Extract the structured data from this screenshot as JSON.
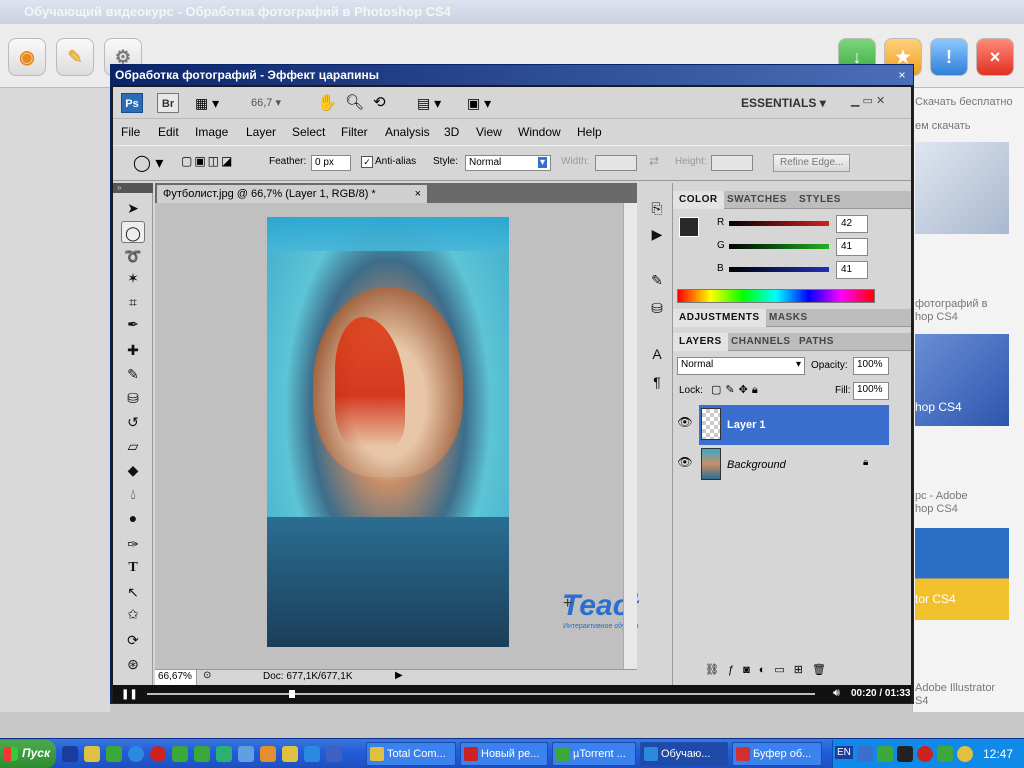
{
  "background_app": {
    "title": "Обучающий видеокурс - Обработка фотографий в Photoshop CS4",
    "side_texts": [
      "Скачать бесплатно",
      "ем скачать",
      "фотографий в",
      "hop CS4",
      "pc - Adobe",
      "hop CS4",
      "Adobe Illustrator",
      "S4"
    ],
    "thumb_texts": [
      "hop CS4",
      "tor CS4"
    ]
  },
  "video_window": {
    "title": "Обработка фотографий - Эффект царапины",
    "close_label": "×"
  },
  "photoshop": {
    "zoom_value": "66,7",
    "workspace_label": "ESSENTIALS",
    "menu": [
      "File",
      "Edit",
      "Image",
      "Layer",
      "Select",
      "Filter",
      "Analysis",
      "3D",
      "View",
      "Window",
      "Help"
    ],
    "options": {
      "feather_label": "Feather:",
      "feather_value": "0 px",
      "antialias_label": "Anti-alias",
      "style_label": "Style:",
      "style_value": "Normal",
      "width_label": "Width:",
      "height_label": "Height:",
      "refine_label": "Refine Edge..."
    },
    "document": {
      "tab_title": "Футболист.jpg @ 66,7% (Layer 1, RGB/8) *",
      "status_zoom": "66,67%",
      "status_doc": "Doc: 677,1K/677,1K"
    },
    "color_panel": {
      "tabs": [
        "COLOR",
        "SWATCHES",
        "STYLES"
      ],
      "channels": [
        {
          "label": "R",
          "value": "42",
          "color": "#d42020"
        },
        {
          "label": "G",
          "value": "41",
          "color": "#22b022"
        },
        {
          "label": "B",
          "value": "41",
          "color": "#2030c0"
        }
      ]
    },
    "adjustments_panel": {
      "tabs": [
        "ADJUSTMENTS",
        "MASKS"
      ]
    },
    "layers_panel": {
      "tabs": [
        "LAYERS",
        "CHANNELS",
        "PATHS"
      ],
      "blend_mode": "Normal",
      "opacity_label": "Opacity:",
      "opacity_value": "100%",
      "lock_label": "Lock:",
      "fill_label": "Fill:",
      "fill_value": "100%",
      "layers": [
        {
          "name": "Layer 1",
          "selected": true
        },
        {
          "name": "Background",
          "selected": false
        }
      ]
    },
    "watermark": "TeachVideo",
    "watermark_sub": "Интерактивное обучающее телевидение"
  },
  "player": {
    "time": "00:20 / 01:33"
  },
  "taskbar": {
    "start_label": "Пуск",
    "buttons": [
      {
        "label": "Total Com...",
        "color": "#e0c040"
      },
      {
        "label": "Новый ре...",
        "color": "#cc2222"
      },
      {
        "label": "µTorrent ...",
        "color": "#3aa83a"
      },
      {
        "label": "Обучаю...",
        "color": "#2a8ae0"
      },
      {
        "label": "Буфер об...",
        "color": "#d03030"
      }
    ],
    "language": "EN",
    "clock": "12:47"
  }
}
